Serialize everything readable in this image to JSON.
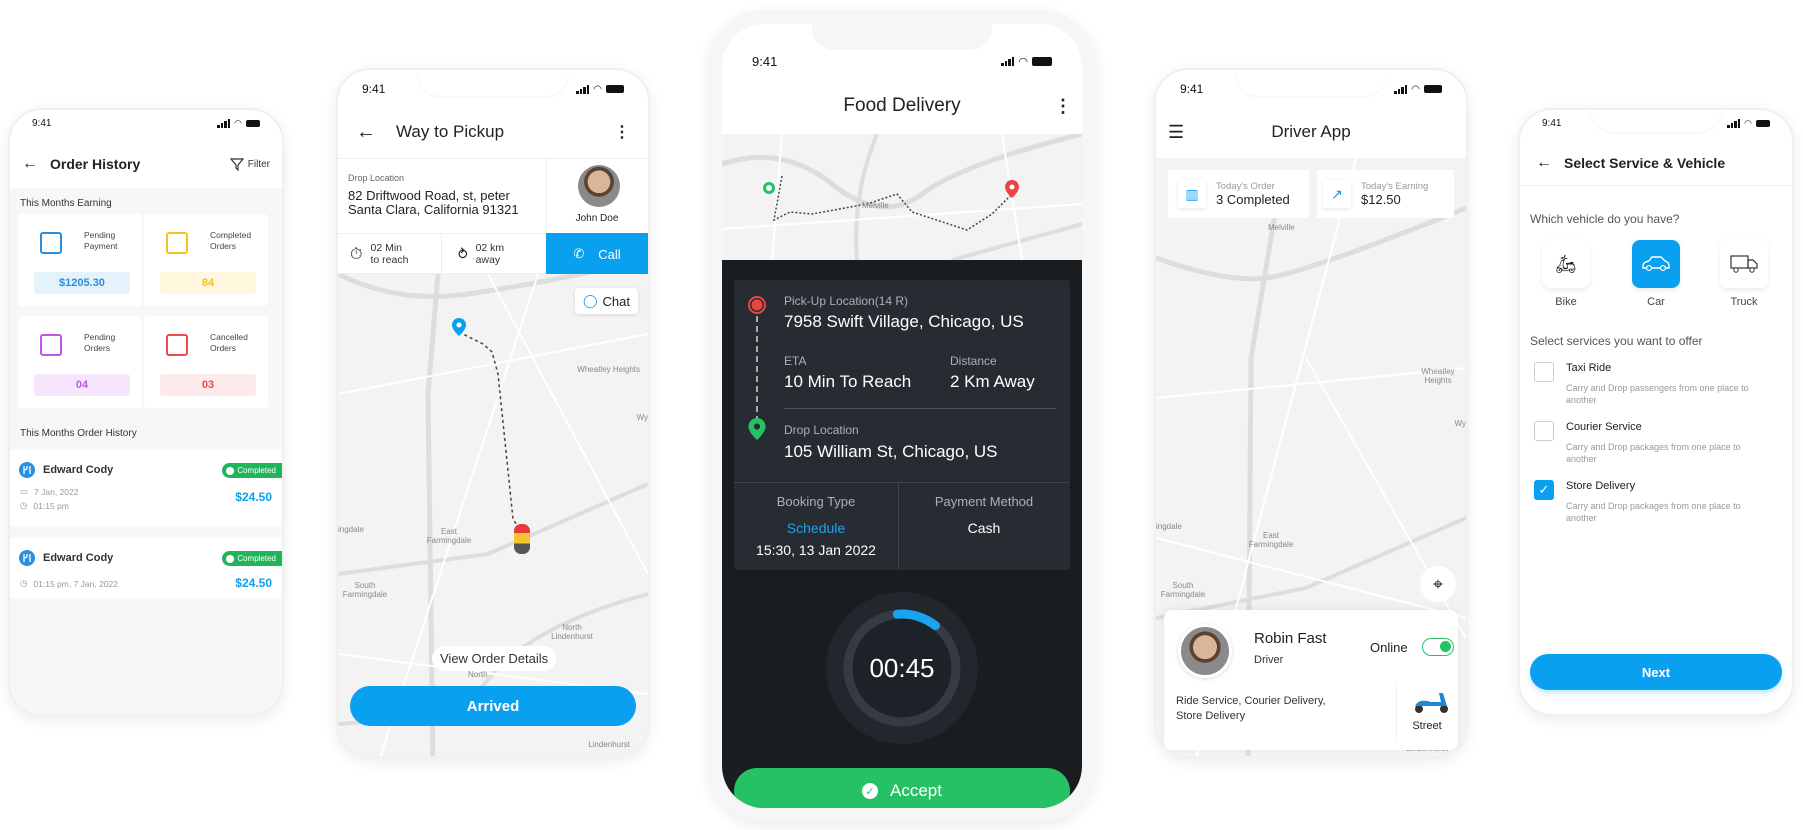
{
  "status_time": "9:41",
  "order_history": {
    "title": "Order History",
    "filter_label": "Filter",
    "earning_section": "This Months Earning",
    "cards": [
      {
        "label_l1": "Pending",
        "label_l2": "Payment",
        "value": "$1205.30",
        "color": "#2a8ee0",
        "bg": "#e4f2fc",
        "icon": "wallet-icon"
      },
      {
        "label_l1": "Completed",
        "label_l2": "Orders",
        "value": "84",
        "color": "#f5c21b",
        "bg": "#fff7de",
        "icon": "document-check-icon"
      },
      {
        "label_l1": "Pending",
        "label_l2": "Orders",
        "value": "04",
        "color": "#c254e8",
        "bg": "#f6e6fd",
        "icon": "hand-box-icon"
      },
      {
        "label_l1": "Cancelled",
        "label_l2": "Orders",
        "value": "03",
        "color": "#ea4a4a",
        "bg": "#fdeaea",
        "icon": "document-cancel-icon"
      }
    ],
    "history_section": "This Months Order History",
    "orders": [
      {
        "name": "Edward Cody",
        "status": "Completed",
        "date": "7 Jan, 2022",
        "time": "01:15 pm",
        "amount": "$24.50"
      },
      {
        "name": "Edward Cody",
        "status": "Completed",
        "datetime": "01:15 pm, 7 Jan, 2022",
        "amount": "$24.50"
      }
    ]
  },
  "pickup": {
    "title": "Way to Pickup",
    "drop_label": "Drop Location",
    "drop_line1": "82  Driftwood Road, st, peter",
    "drop_line2": "Santa Clara, California 91321",
    "customer_name": "John Doe",
    "time_l1": "02 Min",
    "time_l2": "to reach",
    "dist_l1": "02 km",
    "dist_l2": "away",
    "call_label": "Call",
    "chat_label": "Chat",
    "view_details": "View Order Details",
    "arrived_label": "Arrived",
    "map_labels": [
      "Wheatley Heights",
      "Wy",
      "ingdale",
      "East Farmingdale",
      "South Farmingdale",
      "North Lindenhurst",
      "North",
      "Lindenhurst"
    ]
  },
  "food": {
    "title": "Food Delivery",
    "map_label": "Melville",
    "pickup_label": "Pick-Up Location(14 R)",
    "pickup_addr": "7958 Swift Village, Chicago, US",
    "eta_label": "ETA",
    "eta_value": "10 Min To Reach",
    "distance_label": "Distance",
    "distance_value": "2 Km Away",
    "drop_label": "Drop Location",
    "drop_addr": "105 William St, Chicago, US",
    "booking_label": "Booking Type",
    "booking_value": "Schedule",
    "booking_time": "15:30, 13 Jan 2022",
    "payment_label": "Payment Method",
    "payment_value": "Cash",
    "timer": "00:45",
    "timer_progress": 0.12,
    "accept_label": "Accept"
  },
  "driver": {
    "title": "Driver App",
    "order_label": "Today's Order",
    "order_value": "3 Completed",
    "earning_label": "Today's Earning",
    "earning_value": "$12.50",
    "name": "Robin Fast",
    "role": "Driver",
    "online_label": "Online",
    "online": true,
    "services": "Ride Service, Courier Delivery, Store Delivery",
    "vehicle": "Street",
    "map_labels": [
      "Melville",
      "Wheatley Heights",
      "Wy",
      "ingdale",
      "East Farmingdale",
      "South Farmingdale",
      "Lindenhurst"
    ]
  },
  "select": {
    "title": "Select Service & Vehicle",
    "vehicle_q": "Which vehicle do you have?",
    "vehicles": [
      {
        "label": "Bike",
        "selected": false
      },
      {
        "label": "Car",
        "selected": true
      },
      {
        "label": "Truck",
        "selected": false
      }
    ],
    "services_q": "Select services you want to offer",
    "services": [
      {
        "title": "Taxi Ride",
        "desc": "Carry and Drop passengers from one place to another",
        "checked": false
      },
      {
        "title": "Courier Service",
        "desc": "Carry and Drop packages from one place to another",
        "checked": false
      },
      {
        "title": "Store Delivery",
        "desc": "Carry and Drop packages from one place to another",
        "checked": true
      }
    ],
    "next_label": "Next"
  },
  "colors": {
    "primary": "#0aa0f0",
    "green": "#26c065",
    "red": "#e84545",
    "dark": "#1a1d20"
  }
}
